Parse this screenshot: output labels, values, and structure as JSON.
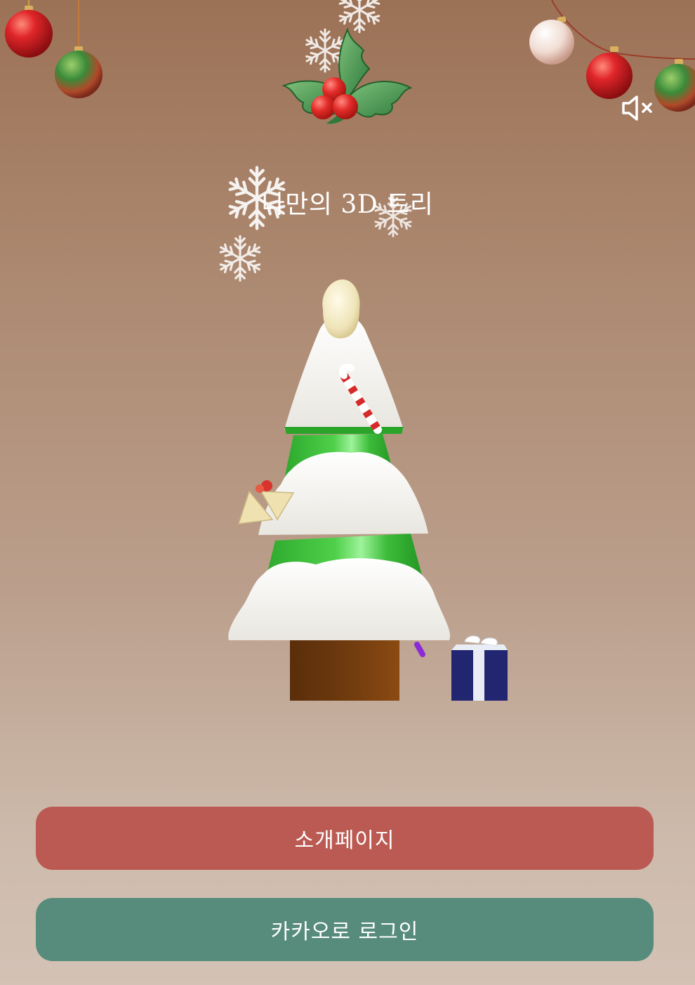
{
  "page": {
    "title": "나만의 3D 트리"
  },
  "controls": {
    "mute_icon": "speaker-muted-icon"
  },
  "buttons": {
    "intro_label": "소개페이지",
    "kakao_login_label": "카카오로 로그인"
  },
  "colors": {
    "intro_button": "#bb5a53",
    "kakao_button": "#578c7c",
    "background_top": "#9c7256",
    "background_bottom": "#d3c2b5"
  },
  "decorations": {
    "ornaments": [
      "red-ornament-icon",
      "green-ornament-icon",
      "white-ornament-icon"
    ],
    "top_center": "holly-icon",
    "scene": "christmas-tree-3d",
    "snowflake": "snowflake-icon"
  }
}
